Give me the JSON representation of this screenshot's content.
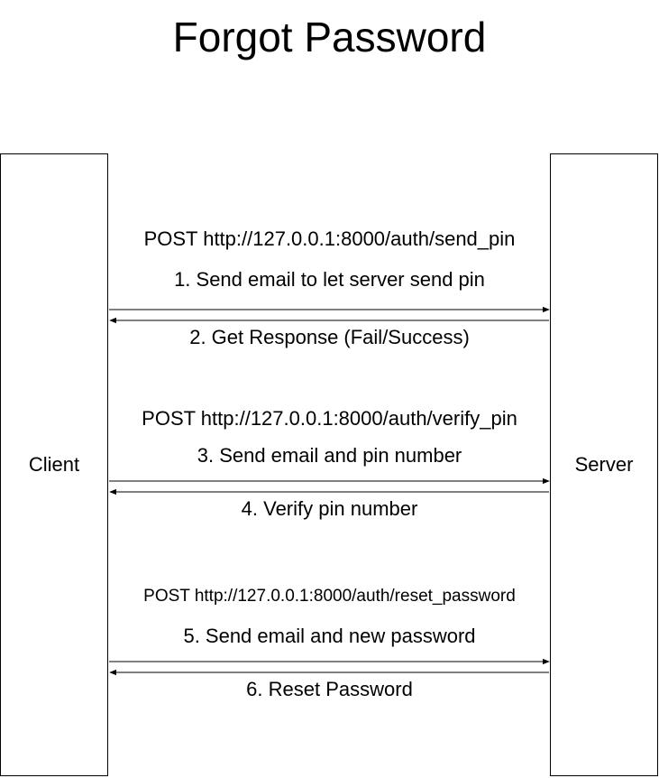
{
  "title": "Forgot Password",
  "actors": {
    "client": "Client",
    "server": "Server"
  },
  "steps": [
    {
      "endpoint": "POST http://127.0.0.1:8000/auth/send_pin",
      "request": "1. Send email to let server send pin",
      "response": "2. Get Response (Fail/Success)"
    },
    {
      "endpoint": "POST http://127.0.0.1:8000/auth/verify_pin",
      "request": "3. Send email and pin number",
      "response": "4. Verify pin number"
    },
    {
      "endpoint": "POST http://127.0.0.1:8000/auth/reset_password",
      "request": "5. Send email and new password",
      "response": "6. Reset Password"
    }
  ]
}
